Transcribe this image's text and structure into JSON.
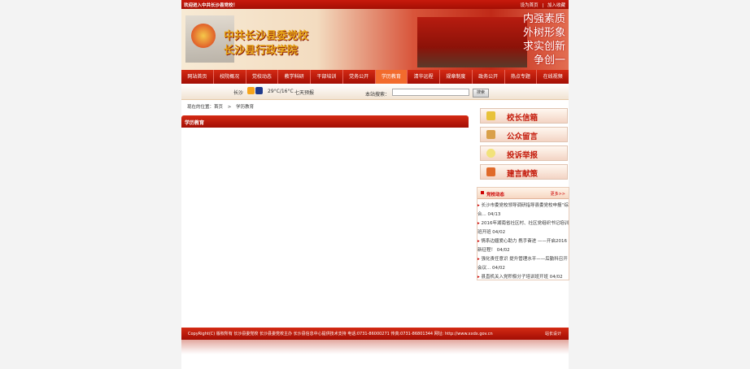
{
  "topbar": {
    "welcome": "欢迎进入中共长沙县党校！",
    "set_home": "设为首页",
    "divider": "|",
    "add_favorite": "加入收藏"
  },
  "banner": {
    "title_line1": "中共长沙县委党校",
    "title_line2": "长沙县行政学院",
    "slogans": [
      "内强素质",
      "外树形象",
      "求实创新",
      "争创一"
    ]
  },
  "nav": {
    "items": [
      "网站首页",
      "校院概况",
      "党校动态",
      "教学科研",
      "干部培训",
      "党务公开",
      "学历教育",
      "清华远程",
      "规章制度",
      "政务公开",
      "热点专题",
      "在线视频"
    ],
    "active_index": 6
  },
  "weather": {
    "city": "长沙",
    "temp": "29°C/16°C",
    "forecast_link": "七天预报"
  },
  "search": {
    "label": "本站搜索：",
    "value": "",
    "button": "搜索"
  },
  "breadcrumb": {
    "prefix": "现在的位置：首页",
    "separator": ">",
    "current": "学历教育"
  },
  "section": {
    "title": "学历教育"
  },
  "right_buttons": [
    {
      "label": "校长信箱",
      "icon": "mailbox-icon",
      "color": "#e8c23a"
    },
    {
      "label": "公众留言",
      "icon": "message-icon",
      "color": "#d9a04a"
    },
    {
      "label": "投诉举报",
      "icon": "lightbulb-icon",
      "color": "#f2e27a"
    },
    {
      "label": "建言献策",
      "icon": "book-icon",
      "color": "#e06a2a"
    }
  ],
  "news": {
    "title": "党校动态",
    "more": "更多>>",
    "items": [
      {
        "text": "长沙市委党校领导调研指导县委党校申报“综合...",
        "date": "04/13"
      },
      {
        "text": "2016年湖南省社区村、社区党组织书记培训班开班",
        "date": "04/02"
      },
      {
        "text": "情系边疆爱心助力 携手奋进 ——开启2016新征程！",
        "date": "04/02"
      },
      {
        "text": "强化责任意识 提升管理水平——后勤科召开会议...",
        "date": "04/02"
      },
      {
        "text": "县直机关入党积极分子培训班开班",
        "date": "04/02"
      }
    ]
  },
  "footer": {
    "text": "CopyRight(C) 版权所有 长沙县委党校 长沙县委党校主办 长沙县信息中心提供技术支持 电话:0731-86000271 传真:0731-86801344 网址: http://www.xxdx.gov.cn",
    "design": "站长设计"
  },
  "colors": {
    "primary_red": "#c41a0a",
    "active_tab": "#f26b2d",
    "page_background": "#f3f3f3"
  }
}
